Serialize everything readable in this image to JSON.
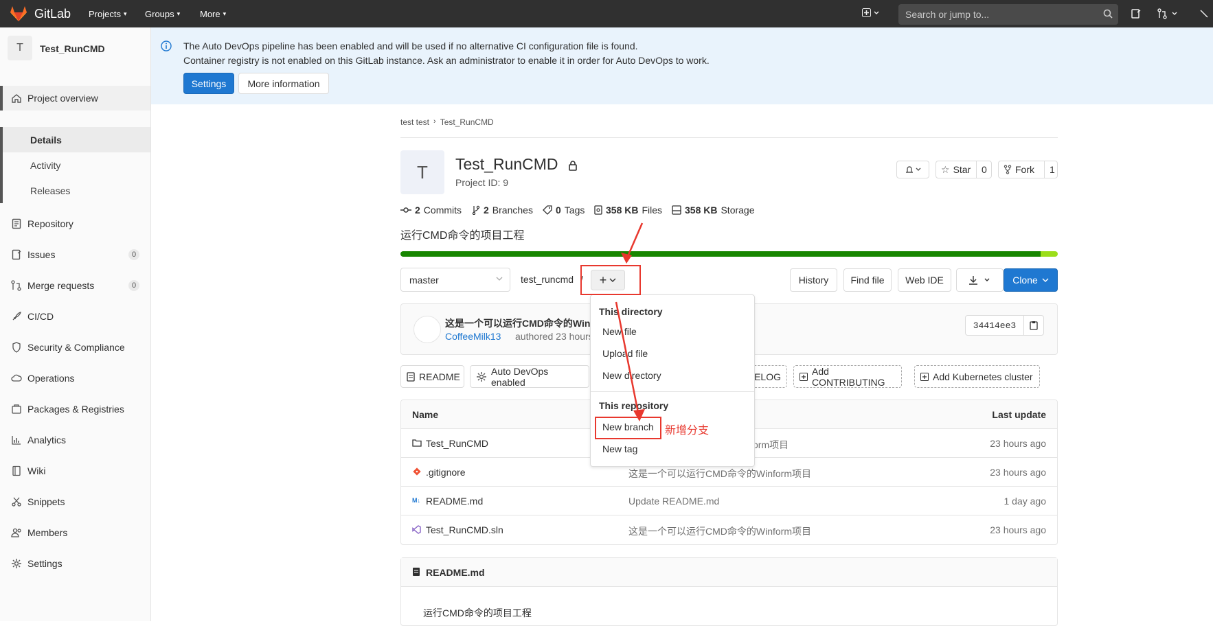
{
  "topnav": {
    "brand": "GitLab",
    "items": [
      "Projects",
      "Groups",
      "More"
    ],
    "search_placeholder": "Search or jump to..."
  },
  "sidebar": {
    "project_avatar_letter": "T",
    "project_name": "Test_RunCMD",
    "overview": "Project overview",
    "sub_items": [
      "Details",
      "Activity",
      "Releases"
    ],
    "items": [
      {
        "label": "Repository",
        "icon": "doc-icon"
      },
      {
        "label": "Issues",
        "icon": "issues-icon",
        "count": "0"
      },
      {
        "label": "Merge requests",
        "icon": "merge-request-icon",
        "count": "0"
      },
      {
        "label": "CI/CD",
        "icon": "rocket-icon"
      },
      {
        "label": "Security & Compliance",
        "icon": "shield-icon"
      },
      {
        "label": "Operations",
        "icon": "cloud-icon"
      },
      {
        "label": "Packages & Registries",
        "icon": "package-icon"
      },
      {
        "label": "Analytics",
        "icon": "chart-icon"
      },
      {
        "label": "Wiki",
        "icon": "book-icon"
      },
      {
        "label": "Snippets",
        "icon": "scissors-icon"
      },
      {
        "label": "Members",
        "icon": "users-icon"
      },
      {
        "label": "Settings",
        "icon": "gear-icon"
      }
    ]
  },
  "banner": {
    "line1": "The Auto DevOps pipeline has been enabled and will be used if no alternative CI configuration file is found.",
    "line2": "Container registry is not enabled on this GitLab instance. Ask an administrator to enable it in order for Auto DevOps to work.",
    "settings_label": "Settings",
    "more_info_label": "More information"
  },
  "breadcrumb": [
    "test test",
    "Test_RunCMD"
  ],
  "project": {
    "avatar_letter": "T",
    "title": "Test_RunCMD",
    "project_id": "Project ID: 9",
    "notify_icon": "bell-icon",
    "star_label": "Star",
    "star_count": "0",
    "fork_label": "Fork",
    "fork_count": "1",
    "stats": [
      {
        "value": "2",
        "label": "Commits"
      },
      {
        "value": "2",
        "label": "Branches"
      },
      {
        "value": "0",
        "label": "Tags"
      },
      {
        "value": "358 KB",
        "label": "Files"
      },
      {
        "value": "358 KB",
        "label": "Storage"
      }
    ],
    "description": "运行CMD命令的项目工程",
    "lang_colors": [
      "#178600",
      "#9bde1a"
    ]
  },
  "toolbar": {
    "branch": "master",
    "path": "test_runcmd",
    "path_sep": "/",
    "add_label": "+",
    "history_label": "History",
    "find_file_label": "Find file",
    "web_ide_label": "Web IDE",
    "clone_label": "Clone"
  },
  "commit": {
    "title": "这是一个可以运行CMD命令的Win",
    "author": "CoffeeMilk13",
    "authored": "authored 23 hours a",
    "sha": "34414ee3"
  },
  "quick_buttons": {
    "readme": "README",
    "auto_devops": "Auto DevOps enabled",
    "changelog_partial": "ELOG",
    "contributing": "Add CONTRIBUTING",
    "kubernetes": "Add Kubernetes cluster"
  },
  "files": {
    "headers": {
      "name": "Name",
      "last_update": "Last update"
    },
    "rows": [
      {
        "name": "Test_RunCMD",
        "icon": "folder-icon",
        "commit": "这是一个可以运行CMD命令的Winform项目",
        "commit_partial": "的Winform项目",
        "time": "23 hours ago"
      },
      {
        "name": ".gitignore",
        "icon": "git-icon",
        "commit": "这是一个可以运行CMD命令的Winform项目",
        "time": "23 hours ago"
      },
      {
        "name": "README.md",
        "icon": "markdown-icon",
        "commit": "Update README.md",
        "time": "1 day ago"
      },
      {
        "name": "Test_RunCMD.sln",
        "icon": "visualstudio-icon",
        "commit": "这是一个可以运行CMD命令的Winform项目",
        "time": "23 hours ago"
      }
    ]
  },
  "readme": {
    "title": "README.md",
    "content": "运行CMD命令的项目工程"
  },
  "dropdown": {
    "section1": "This directory",
    "dir_items": [
      "New file",
      "Upload file",
      "New directory"
    ],
    "section2": "This repository",
    "repo_items": [
      "New branch",
      "New tag"
    ]
  },
  "annotation": {
    "text": "新增分支",
    "color": "#e8382e"
  }
}
